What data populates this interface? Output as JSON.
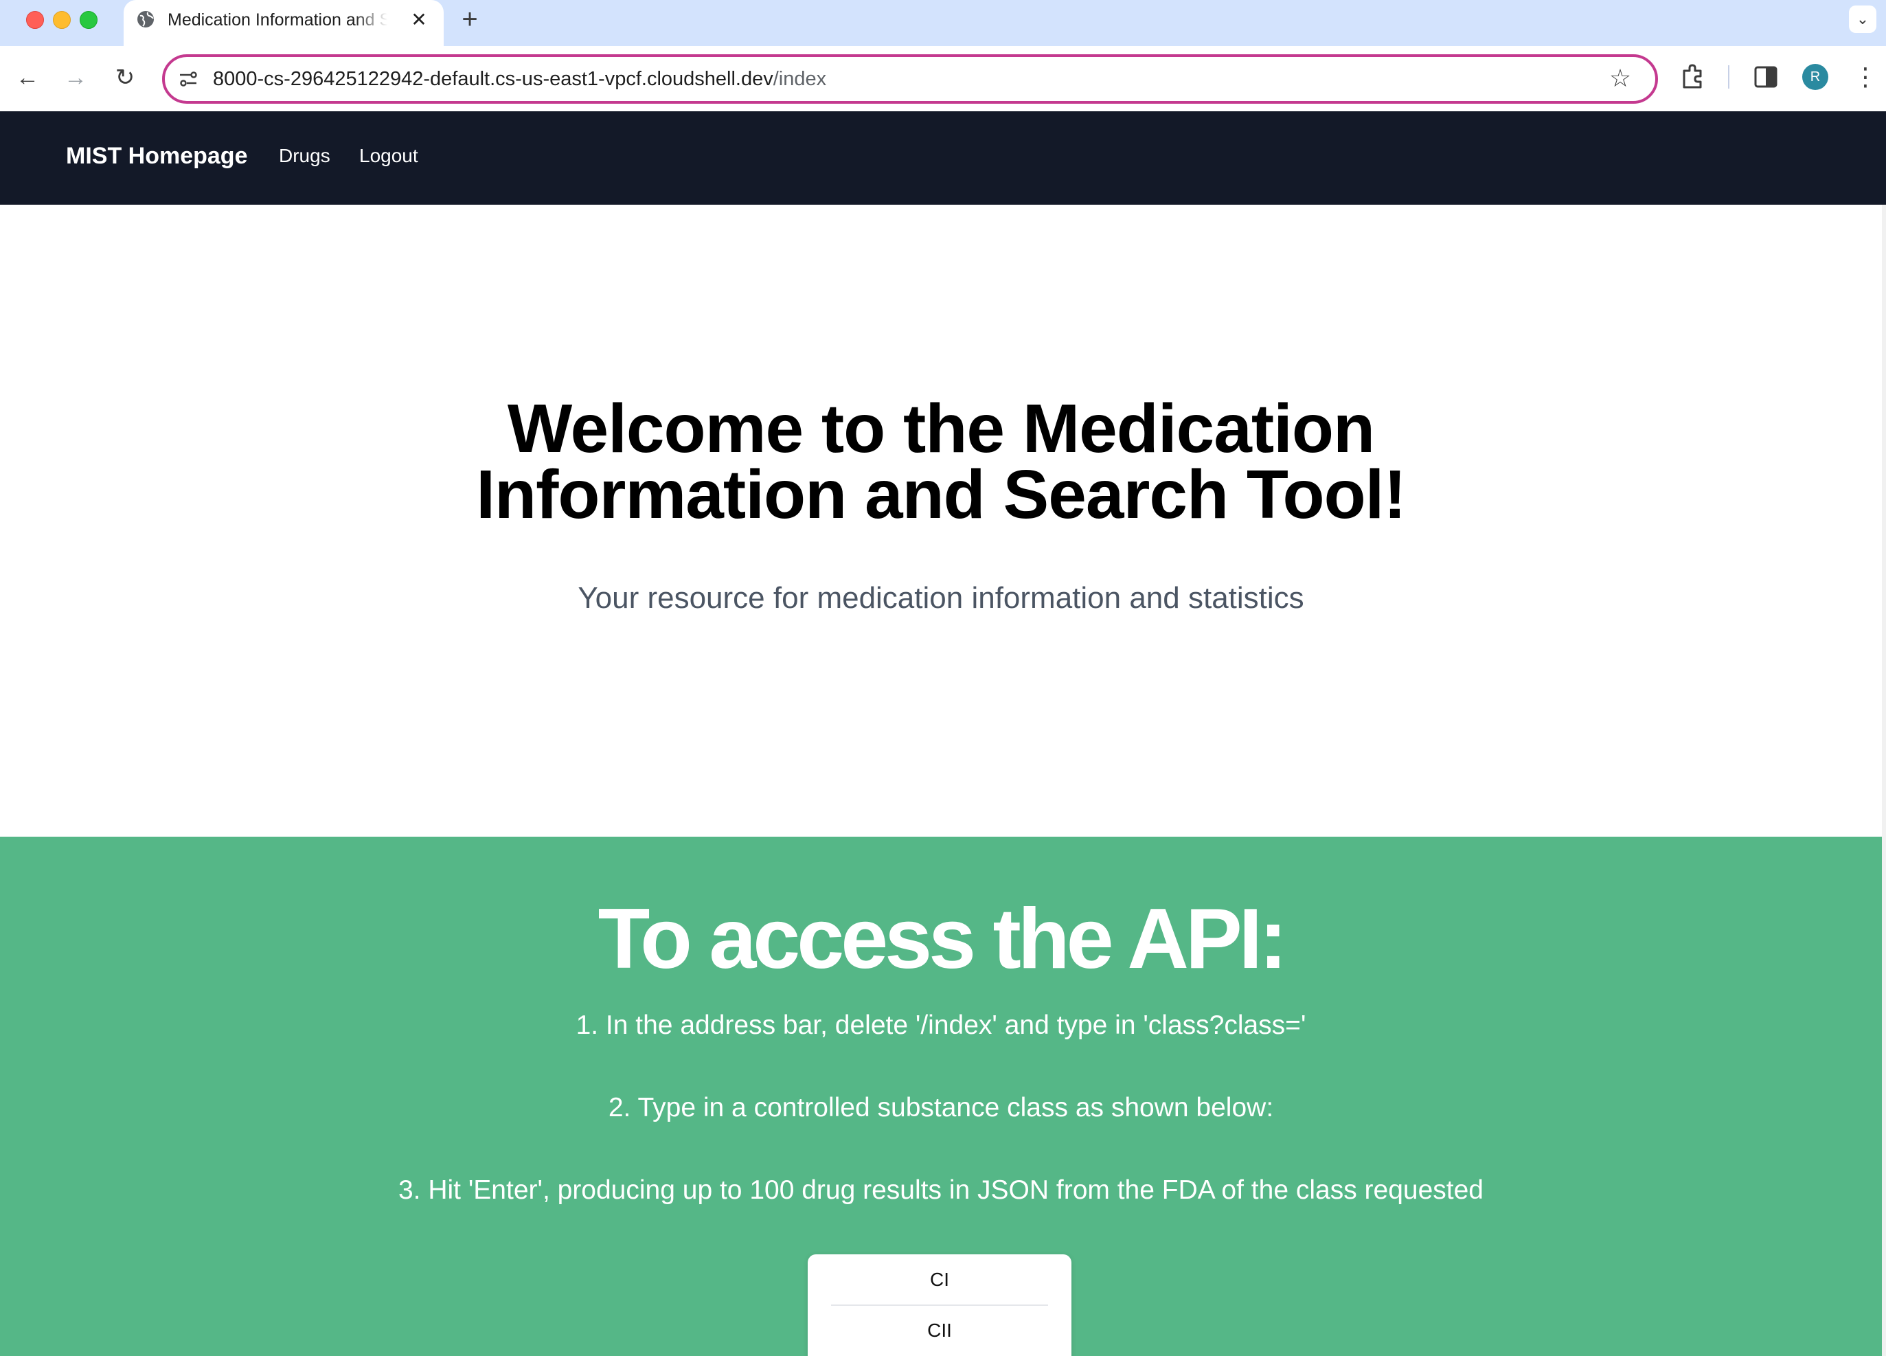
{
  "browser": {
    "tab": {
      "title": "Medication Information and Search Tool",
      "close_glyph": "✕"
    },
    "new_tab_glyph": "+",
    "tab_search_glyph": "⌄",
    "nav": {
      "back_glyph": "←",
      "forward_glyph": "→",
      "reload_glyph": "↻"
    },
    "address": {
      "host": "8000-cs-296425122942-default.cs-us-east1-vpcf.cloudshell.dev",
      "path": "/index"
    },
    "bookmark_glyph": "☆",
    "profile_initial": "R",
    "menu_glyph": "⋮",
    "icons": [
      "globe-icon",
      "site-info-icon",
      "extensions-icon",
      "side-panel-icon"
    ],
    "colors": {
      "tabstrip": "#d3e3fd",
      "omnibox_border": "#c4398f",
      "avatar": "#2a8aa0"
    }
  },
  "navbar": {
    "brand": "MIST Homepage",
    "links": [
      "Drugs",
      "Logout"
    ]
  },
  "hero": {
    "title_line1": "Welcome to the Medication",
    "title_line2": "Information and Search Tool!",
    "subtitle": "Your resource for medication information and statistics"
  },
  "api": {
    "title": "To access the API:",
    "steps": [
      "1. In the address bar, delete '/index' and type in 'class?class='",
      "2. Type in a controlled substance class as shown below:",
      "3. Hit 'Enter', producing up to 100 drug results in JSON from the FDA of the class requested"
    ],
    "classes": [
      "CI",
      "CII"
    ]
  },
  "theme": {
    "navbar_bg": "#131928",
    "api_bg": "#55b787",
    "subtitle_color": "#4b5563"
  }
}
